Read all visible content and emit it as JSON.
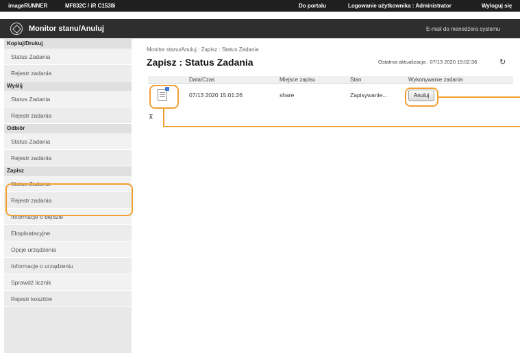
{
  "topbar": {
    "brand": "imageRUNNER",
    "model": "MF832C / iR C1538i",
    "portal_link": "Do portalu",
    "login_info": "Logowanie użytkownika : Administrator",
    "logout_link": "Wyloguj się"
  },
  "header": {
    "title": "Monitor stanu/Anuluj",
    "email_link": "E-mail do menedżera systemu"
  },
  "sidebar": {
    "sections": [
      {
        "label": "Kopiuj/Drukuj",
        "items": [
          "Status Zadania",
          "Rejestr zadania"
        ]
      },
      {
        "label": "Wyślij",
        "items": [
          "Status Zadania",
          "Rejestr zadania"
        ]
      },
      {
        "label": "Odbiór",
        "items": [
          "Status Zadania",
          "Rejestr zadania"
        ]
      },
      {
        "label": "Zapisz",
        "items": [
          "Status Zadania",
          "Rejestr zadania"
        ]
      }
    ],
    "extra_items": [
      "Informacje o błędzie",
      "Eksploatacyjne",
      "Opcje urządzenia",
      "Informacje o urządzeniu",
      "Sprawdź licznik",
      "Rejestr kosztów"
    ]
  },
  "main": {
    "breadcrumb": "Monitor stanu/Anuluj : Zapisz : Status Zadania",
    "page_title": "Zapisz : Status Zadania",
    "last_update": "Ostatnia aktualizacja : 07/13 2020 15:02:36",
    "refresh_icon": "refresh-icon",
    "table": {
      "columns": [
        "Data/Czas",
        "Miejsce zapisu",
        "Stan",
        "Wykonywanie zadania"
      ],
      "rows": [
        {
          "datetime": "07/13 2020 15:01:26",
          "location": "share",
          "status": "Zapisywanie...",
          "action_label": "Anuluj"
        }
      ]
    },
    "top_arrow_icon": "back-to-top-icon"
  },
  "colors": {
    "highlight": "#f0a030",
    "topbar_bg": "#1f1f1f",
    "titlebar_bg": "#2e2e2e",
    "sidebar_bg": "#e8e8e8"
  }
}
